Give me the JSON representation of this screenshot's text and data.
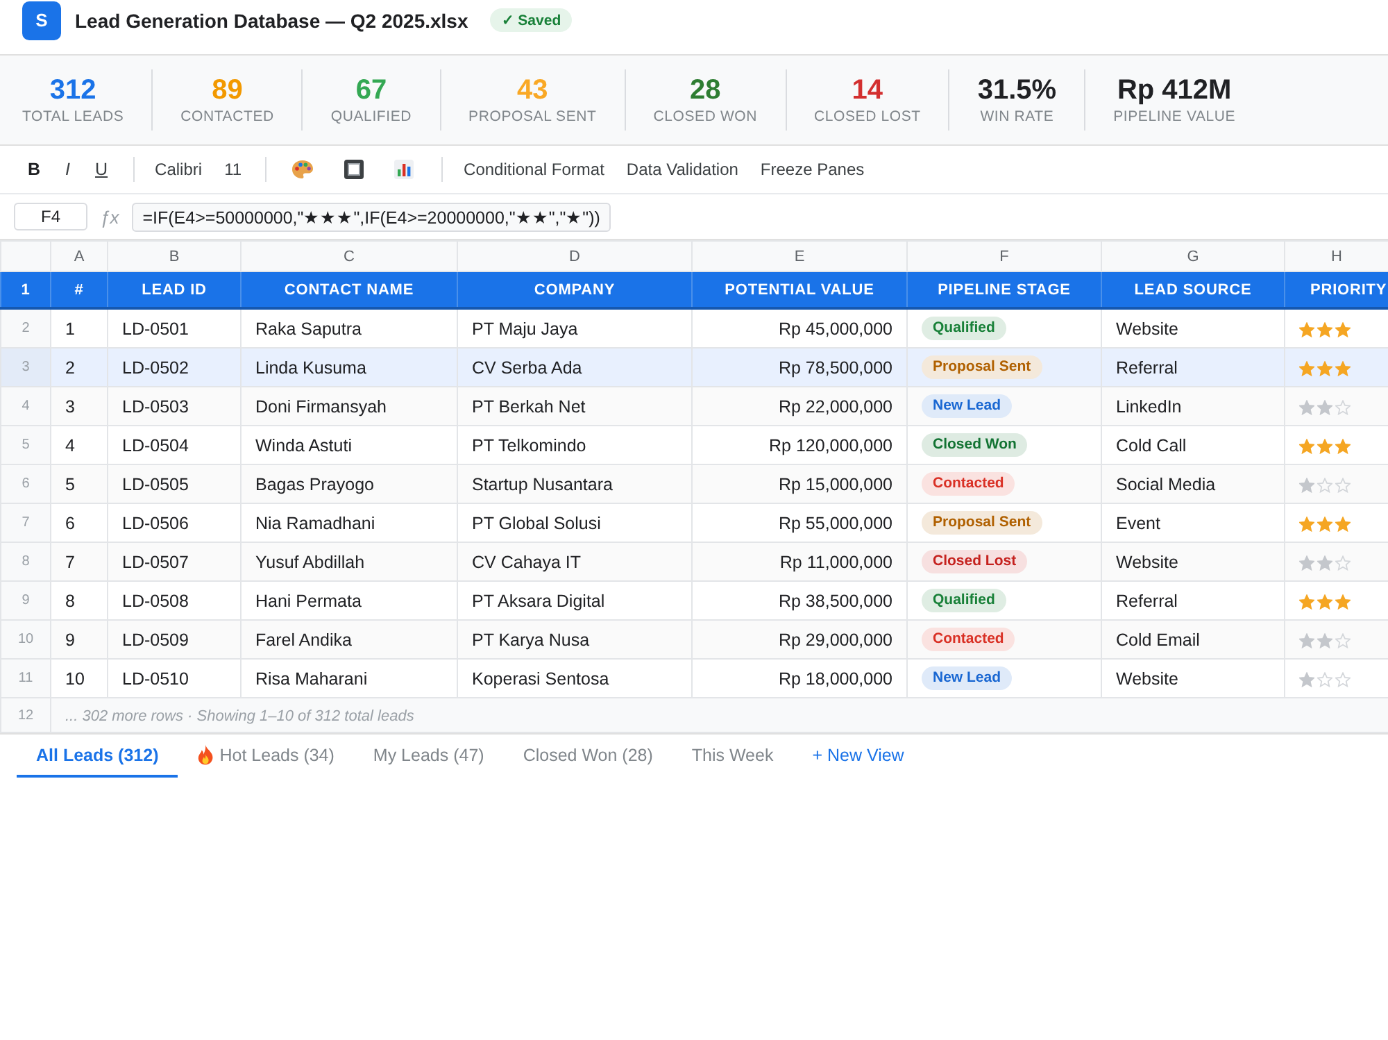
{
  "header": {
    "logo": "S",
    "title": "Lead Generation Database — Q2 2025.xlsx",
    "status": "✓ Saved"
  },
  "stats": [
    {
      "value": "312",
      "label": "TOTAL LEADS",
      "color": "#1a73e8"
    },
    {
      "value": "89",
      "label": "CONTACTED",
      "color": "#f29900"
    },
    {
      "value": "67",
      "label": "QUALIFIED",
      "color": "#34a853"
    },
    {
      "value": "43",
      "label": "PROPOSAL SENT",
      "color": "#f9a825"
    },
    {
      "value": "28",
      "label": "CLOSED WON",
      "color": "#2e7d32"
    },
    {
      "value": "14",
      "label": "CLOSED LOST",
      "color": "#d32f2f"
    },
    {
      "value": "31.5%",
      "label": "WIN RATE",
      "color": "#202124"
    },
    {
      "value": "Rp 412M",
      "label": "PIPELINE VALUE",
      "color": "#202124"
    }
  ],
  "toolbar": {
    "groups": [
      [
        {
          "kind": "bold",
          "label": "B"
        },
        {
          "kind": "italic",
          "label": "I"
        },
        {
          "kind": "underline",
          "label": "U"
        }
      ],
      [
        {
          "kind": "text",
          "label": "Calibri"
        },
        {
          "kind": "text",
          "label": "11"
        }
      ],
      [
        {
          "kind": "fill-color"
        },
        {
          "kind": "borders"
        },
        {
          "kind": "chart"
        }
      ],
      [
        {
          "kind": "text",
          "label": "Conditional Format"
        },
        {
          "kind": "text",
          "label": "Data Validation"
        },
        {
          "kind": "text",
          "label": "Freeze Panes"
        }
      ]
    ]
  },
  "formula_bar": {
    "cell": "F4",
    "fx": "ƒx",
    "formula": "=IF(E4>=50000000,\"★★★\",IF(E4>=20000000,\"★★\",\"★\"))"
  },
  "table": {
    "column_letters": [
      "A",
      "B",
      "C",
      "D",
      "E",
      "F",
      "G",
      "H"
    ],
    "header_row_number": "1",
    "columns": [
      "#",
      "LEAD ID",
      "CONTACT NAME",
      "COMPANY",
      "POTENTIAL VALUE",
      "PIPELINE STAGE",
      "LEAD SOURCE",
      "PRIORITY"
    ],
    "rows": [
      {
        "row_number": "2",
        "selected": false,
        "no": "1",
        "lead_id": "LD-0501",
        "contact": "Raka Saputra",
        "company": "PT Maju Jaya",
        "value": "Rp 45,000,000",
        "stage": {
          "label": "Qualified",
          "color": "#188038"
        },
        "source": "Website",
        "stars": 3
      },
      {
        "row_number": "3",
        "selected": true,
        "no": "2",
        "lead_id": "LD-0502",
        "contact": "Linda Kusuma",
        "company": "CV Serba Ada",
        "value": "Rp 78,500,000",
        "stage": {
          "label": "Proposal Sent",
          "color": "#b06000"
        },
        "source": "Referral",
        "stars": 3
      },
      {
        "row_number": "4",
        "selected": false,
        "no": "3",
        "lead_id": "LD-0503",
        "contact": "Doni Firmansyah",
        "company": "PT Berkah Net",
        "value": "Rp 22,000,000",
        "stage": {
          "label": "New Lead",
          "color": "#1967d2"
        },
        "source": "LinkedIn",
        "stars": 2
      },
      {
        "row_number": "5",
        "selected": false,
        "no": "4",
        "lead_id": "LD-0504",
        "contact": "Winda Astuti",
        "company": "PT Telkomindo",
        "value": "Rp 120,000,000",
        "stage": {
          "label": "Closed Won",
          "color": "#137333"
        },
        "source": "Cold Call",
        "stars": 3
      },
      {
        "row_number": "6",
        "selected": false,
        "no": "5",
        "lead_id": "LD-0505",
        "contact": "Bagas Prayogo",
        "company": "Startup Nusantara",
        "value": "Rp 15,000,000",
        "stage": {
          "label": "Contacted",
          "color": "#d93025"
        },
        "source": "Social Media",
        "stars": 1
      },
      {
        "row_number": "7",
        "selected": false,
        "no": "6",
        "lead_id": "LD-0506",
        "contact": "Nia Ramadhani",
        "company": "PT Global Solusi",
        "value": "Rp 55,000,000",
        "stage": {
          "label": "Proposal Sent",
          "color": "#b06000"
        },
        "source": "Event",
        "stars": 3
      },
      {
        "row_number": "8",
        "selected": false,
        "no": "7",
        "lead_id": "LD-0507",
        "contact": "Yusuf Abdillah",
        "company": "CV Cahaya IT",
        "value": "Rp 11,000,000",
        "stage": {
          "label": "Closed Lost",
          "color": "#c5221f"
        },
        "source": "Website",
        "stars": 2
      },
      {
        "row_number": "9",
        "selected": false,
        "no": "8",
        "lead_id": "LD-0508",
        "contact": "Hani Permata",
        "company": "PT Aksara Digital",
        "value": "Rp 38,500,000",
        "stage": {
          "label": "Qualified",
          "color": "#188038"
        },
        "source": "Referral",
        "stars": 3
      },
      {
        "row_number": "10",
        "selected": false,
        "no": "9",
        "lead_id": "LD-0509",
        "contact": "Farel Andika",
        "company": "PT Karya Nusa",
        "value": "Rp 29,000,000",
        "stage": {
          "label": "Contacted",
          "color": "#d93025"
        },
        "source": "Cold Email",
        "stars": 2
      },
      {
        "row_number": "11",
        "selected": false,
        "no": "10",
        "lead_id": "LD-0510",
        "contact": "Risa Maharani",
        "company": "Koperasi Sentosa",
        "value": "Rp 18,000,000",
        "stage": {
          "label": "New Lead",
          "color": "#1967d2"
        },
        "source": "Website",
        "stars": 1
      }
    ],
    "footer": {
      "row_number": "12",
      "text": "... 302 more rows · Showing 1–10 of 312 total leads"
    }
  },
  "view_tabs": [
    {
      "kind": "view",
      "label": "All Leads (312)",
      "selected": true
    },
    {
      "kind": "hot",
      "label": "Hot Leads (34)",
      "selected": false
    },
    {
      "kind": "view",
      "label": "My Leads (47)",
      "selected": false
    },
    {
      "kind": "view",
      "label": "Closed Won (28)",
      "selected": false
    },
    {
      "kind": "view",
      "label": "This Week",
      "selected": false
    },
    {
      "kind": "add",
      "label": "+ New View",
      "selected": false
    }
  ]
}
